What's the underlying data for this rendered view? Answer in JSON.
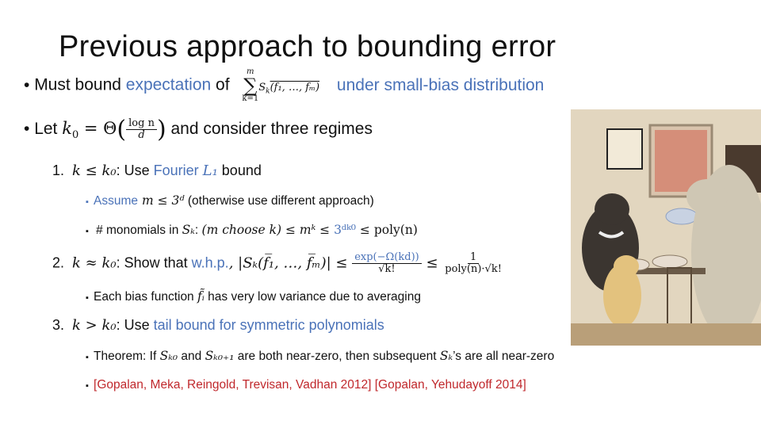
{
  "slide": {
    "title": "Previous approach to bounding error",
    "bullets": {
      "b1": {
        "prefix": "Must bound ",
        "highlight": "expectation",
        "mid": " of",
        "sum_upper": "m",
        "sum_lower": "k=1",
        "sum_body": "S",
        "sum_sub": "k",
        "sum_args": "(f₁, …, fₘ)",
        "suffix": "under small-bias distribution"
      },
      "b2": {
        "prefix": "Let ",
        "var": "k",
        "sub": "0",
        "eq": " = Θ",
        "frac_num": "log n",
        "frac_den": "d",
        "suffix": " and consider three regimes"
      },
      "regime1": {
        "num": "1.",
        "cond": "k ≤ k₀",
        "text": ": Use ",
        "highlight": "Fourier ",
        "highlight_math": "L₁",
        "suffix": " bound",
        "sub_a": {
          "highlight": "Assume",
          "math": " m ≤ 3ᵈ",
          "suffix": " (otherwise use different approach)"
        },
        "sub_b": {
          "prefix": "# monomials in ",
          "math1": "Sₖ",
          "colon": ": ",
          "math2": "(m choose k) ≤ mᵏ ≤ ",
          "highlight": "3ᵈᵏ⁰",
          "math3": " ≤ poly(n)"
        }
      },
      "regime2": {
        "num": "2.",
        "cond": "k ≈ k₀",
        "text": ": Show that ",
        "highlight": "w.h.p.",
        "math_lhs": ", |Sₖ(f̅₁, …, f̅ₘ)| ≤ ",
        "frac1_num": "exp(−Ω(kd))",
        "frac1_den": "√k!",
        "leq": " ≤ ",
        "frac2_num": "1",
        "frac2_den": "poly(n)·√k!",
        "sub_a": {
          "prefix": "Each bias function ",
          "math": "f̃ᵢ",
          "suffix": " has very low variance due to averaging"
        }
      },
      "regime3": {
        "num": "3.",
        "cond": "k > k₀",
        "text": ": Use ",
        "highlight": "tail bound for symmetric polynomials",
        "sub_a": {
          "prefix": "Theorem: If ",
          "m1": "Sₖ₀",
          "mid1": " and ",
          "m2": "Sₖ₀₊₁",
          "mid2": " are both near-zero, then subsequent ",
          "m3": "Sₖ",
          "suffix": "’s are all near-zero"
        },
        "sub_b": {
          "citation": "[Gopalan, Meka, Reingold, Trevisan, Vadhan 2012] [Gopalan, Yehudayoff 2014]"
        }
      }
    },
    "illustration": {
      "description": "three-bears-illustration"
    },
    "colors": {
      "accent_blue": "#4a72b8",
      "citation_red": "#c0282c",
      "text": "#111111"
    }
  }
}
